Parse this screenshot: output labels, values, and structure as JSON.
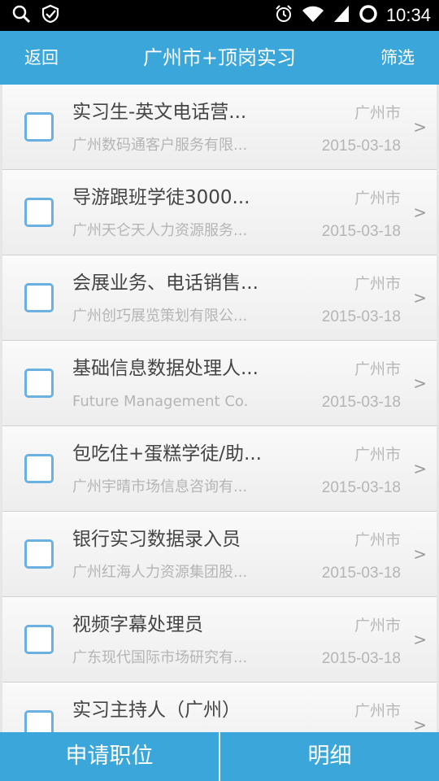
{
  "status_bar": {
    "time": "10:34",
    "left_icons": [
      "search-icon",
      "shield-check-icon"
    ],
    "right_icons": [
      "alarm-icon",
      "wifi-icon",
      "signal-icon",
      "sync-icon"
    ]
  },
  "header": {
    "back_label": "返回",
    "title": "广州市+顶岗实习",
    "filter_label": "筛选"
  },
  "jobs": [
    {
      "title": "实习生-英文电话营...",
      "company": "广州数码通客户服务有限...",
      "city": "广州市",
      "date": "2015-03-18"
    },
    {
      "title": "导游跟班学徒3000...",
      "company": "广州天仑天人力资源服务...",
      "city": "广州市",
      "date": "2015-03-18"
    },
    {
      "title": "会展业务、电话销售...",
      "company": "广州创巧展览策划有限公...",
      "city": "广州市",
      "date": "2015-03-18"
    },
    {
      "title": "基础信息数据处理人...",
      "company": "Future Management Co.",
      "city": "广州市",
      "date": "2015-03-18"
    },
    {
      "title": "包吃住+蛋糕学徒/助...",
      "company": "广州宇晴市场信息咨询有...",
      "city": "广州市",
      "date": "2015-03-18"
    },
    {
      "title": "银行实习数据录入员",
      "company": "广州红海人力资源集团股...",
      "city": "广州市",
      "date": "2015-03-18"
    },
    {
      "title": "视频字幕处理员",
      "company": "广东现代国际市场研究有...",
      "city": "广州市",
      "date": "2015-03-18"
    },
    {
      "title": "实习主持人（广州）",
      "company": "",
      "city": "广州市",
      "date": ""
    }
  ],
  "row_arrow": ">",
  "bottom": {
    "apply_label": "申请职位",
    "detail_label": "明细"
  },
  "colors": {
    "primary": "#3aa6d9",
    "checkbox_border": "#6ab0e0",
    "title_text": "#444444",
    "muted_text": "#b5b5b5"
  }
}
